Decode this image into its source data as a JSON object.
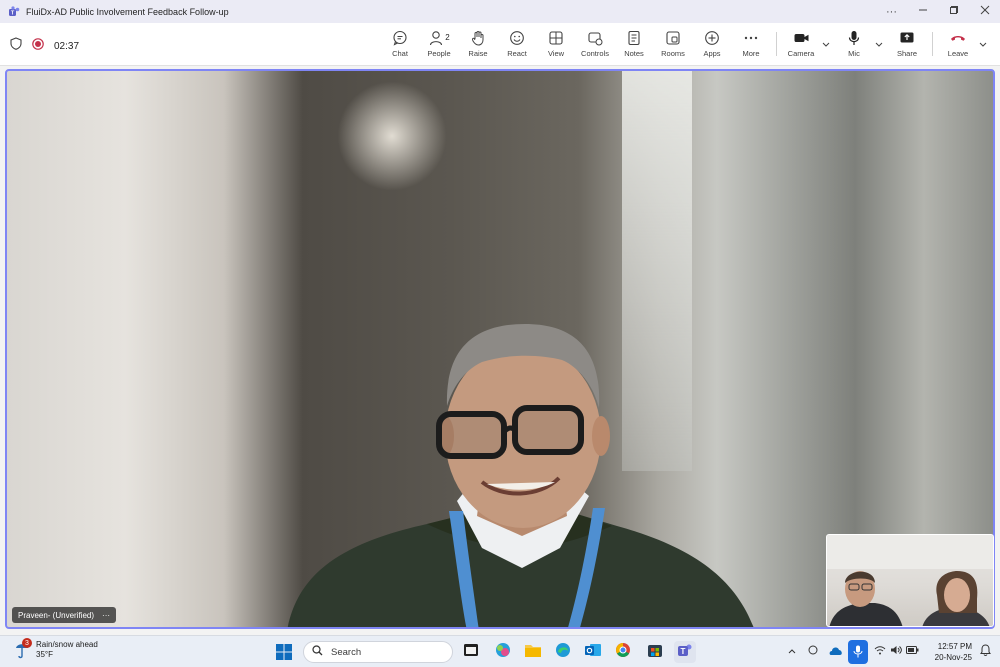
{
  "window": {
    "title": "FluiDx-AD Public Involvement Feedback Follow-up",
    "controls": [
      "more-icon",
      "minimize-icon",
      "maximize-icon",
      "close-icon"
    ]
  },
  "meeting": {
    "timer": "02:37",
    "toolbar": {
      "chat": "Chat",
      "people": "People",
      "people_count": "2",
      "raise": "Raise",
      "react": "React",
      "view": "View",
      "controls": "Controls",
      "notes": "Notes",
      "rooms": "Rooms",
      "apps": "Apps",
      "more": "More",
      "camera": "Camera",
      "mic": "Mic",
      "share": "Share",
      "leave": "Leave"
    },
    "main_participant": {
      "name": "Praveen- (Unverified)",
      "more_glyph": "···"
    },
    "accent_color": "#7f85f5",
    "leave_color": "#c4314b"
  },
  "taskbar": {
    "weather": {
      "text": "Rain/snow ahead",
      "temp": "35°F",
      "badge": "3"
    },
    "search_placeholder": "Search",
    "apps": [
      "file-explorer-icon",
      "copilot-icon",
      "folder-icon",
      "edge-icon",
      "outlook-icon",
      "chrome-icon",
      "store-icon",
      "teams-icon"
    ],
    "tray": [
      "chevron-up-icon",
      "sync-icon",
      "onedrive-icon",
      "mic-active-icon",
      "wifi-icon",
      "volume-icon",
      "battery-icon"
    ],
    "time": "12:57 PM",
    "date": "20-Nov-25"
  }
}
